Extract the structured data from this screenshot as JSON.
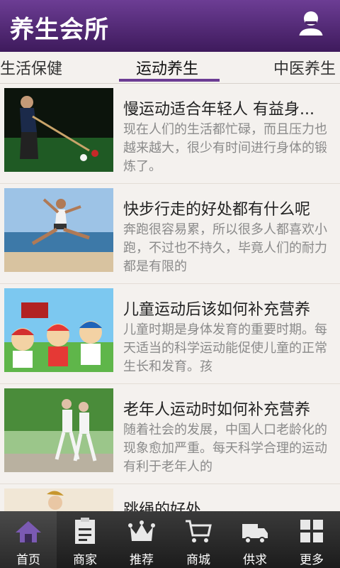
{
  "header": {
    "title": "养生会所"
  },
  "tabs": [
    {
      "label": "生活保健"
    },
    {
      "label": "运动养生"
    },
    {
      "label": "中医养生"
    }
  ],
  "articles": [
    {
      "title": "慢运动适合年轻人 有益身...",
      "desc": "现在人们的生活都忙碌，而且压力也越来越大，很少有时间进行身体的锻炼了。"
    },
    {
      "title": "快步行走的好处都有什么呢",
      "desc": "奔跑很容易累，所以很多人都喜欢小跑，不过也不持久，毕竟人们的耐力都是有限的"
    },
    {
      "title": "儿童运动后该如何补充营养",
      "desc": "儿童时期是身体发育的重要时期。每天适当的科学运动能促使儿童的正常生长和发育。孩"
    },
    {
      "title": "老年人运动时如何补充营养",
      "desc": "随着社会的发展，中国人口老龄化的现象愈加严重。每天科学合理的运动有利于老年人的"
    },
    {
      "title": "跳绳的好处",
      "desc": ""
    }
  ],
  "nav": [
    {
      "label": "首页"
    },
    {
      "label": "商家"
    },
    {
      "label": "推荐"
    },
    {
      "label": "商城"
    },
    {
      "label": "供求"
    },
    {
      "label": "更多"
    }
  ],
  "colors": {
    "header": "#5a2d82",
    "accent": "#6c3d94",
    "nav_bg": "#2a2a2a"
  }
}
